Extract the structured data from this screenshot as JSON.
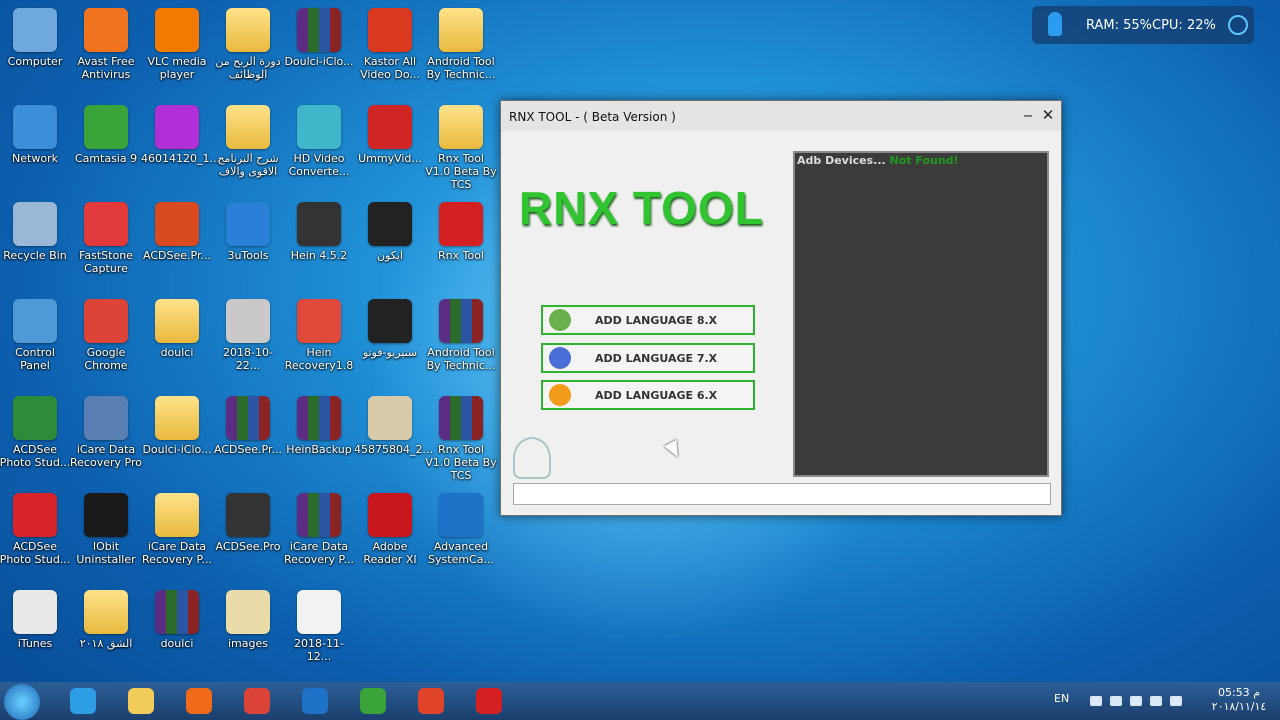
{
  "desktop": {
    "icons": [
      {
        "label": "Computer",
        "color": "#6fa8dc"
      },
      {
        "label": "Avast Free Antivirus",
        "color": "#f0731f"
      },
      {
        "label": "VLC media player",
        "color": "#f07b00"
      },
      {
        "label": "دورة الربح من الوظائف",
        "color": "folder"
      },
      {
        "label": "Doulci-iClo...",
        "color": "rar"
      },
      {
        "label": "Kastor All Video Do...",
        "color": "#d93a1f"
      },
      {
        "label": "Android Tool By Technic...",
        "color": "folder"
      },
      {
        "label": "Network",
        "color": "#3a8fd8"
      },
      {
        "label": "Camtasia 9",
        "color": "#3aa33a"
      },
      {
        "label": "46014120_1...",
        "color": "#b12fd6"
      },
      {
        "label": "شرح البرنامج الاقوى والاف",
        "color": "folder"
      },
      {
        "label": "HD Video Converte...",
        "color": "#3fb6c9"
      },
      {
        "label": "UmmyVid...",
        "color": "#d02525"
      },
      {
        "label": "Rnx Tool V1.0 Beta By TCS",
        "color": "folder"
      },
      {
        "label": "Recycle Bin",
        "color": "#9ab7d6"
      },
      {
        "label": "FastStone Capture",
        "color": "#e23a3a"
      },
      {
        "label": "ACDSee.Pr...",
        "color": "#d94b1f"
      },
      {
        "label": "3uTools",
        "color": "#2a7fd6"
      },
      {
        "label": "Hein 4.5.2",
        "color": "#333333"
      },
      {
        "label": "ايكون",
        "color": "#222222"
      },
      {
        "label": "Rnx Tool",
        "color": "#d42020"
      },
      {
        "label": "Control Panel",
        "color": "#4f9ad6"
      },
      {
        "label": "Google Chrome",
        "color": "#db4437"
      },
      {
        "label": "doulci",
        "color": "folder"
      },
      {
        "label": "2018-10-22...",
        "color": "#c9c9c9"
      },
      {
        "label": "Hein Recovery1.8",
        "color": "#e04a3a"
      },
      {
        "label": "ستيريو-فوتو",
        "color": "#222222"
      },
      {
        "label": "Android Tool By Technic...",
        "color": "rar"
      },
      {
        "label": "ACDSee Photo Stud...",
        "color": "#2e8b3a"
      },
      {
        "label": "iCare Data Recovery Pro",
        "color": "#5a7fb3"
      },
      {
        "label": "Doulci-iClo...",
        "color": "folder"
      },
      {
        "label": "ACDSee.Pr...",
        "color": "rar"
      },
      {
        "label": "HeinBackup",
        "color": "rar"
      },
      {
        "label": "45875804_2...",
        "color": "#d8c9a8"
      },
      {
        "label": "Rnx Tool V1.0 Beta By TCS",
        "color": "rar"
      },
      {
        "label": "ACDSee Photo Stud...",
        "color": "#d8232a"
      },
      {
        "label": "IObit Uninstaller",
        "color": "#1a1a1a"
      },
      {
        "label": "iCare Data Recovery P...",
        "color": "folder"
      },
      {
        "label": "ACDSee.Pro",
        "color": "#333333"
      },
      {
        "label": "iCare Data Recovery P...",
        "color": "rar"
      },
      {
        "label": "Adobe Reader XI",
        "color": "#c8161d"
      },
      {
        "label": "Advanced SystemCa...",
        "color": "#1e73c9"
      },
      {
        "label": "iTunes",
        "color": "#e9e9e9"
      },
      {
        "label": "الشق ٢٠١٨",
        "color": "folder"
      },
      {
        "label": "doulci",
        "color": "rar"
      },
      {
        "label": "images",
        "color": "#e9dca8"
      },
      {
        "label": "2018-11-12...",
        "color": "#f2f2f2"
      }
    ]
  },
  "widget": {
    "ram": "RAM: 55%",
    "cpu": "CPU: 22%"
  },
  "window": {
    "title": "RNX TOOL - ( Beta Version )",
    "minimize": "‒",
    "close": "✕",
    "logo": "RNX TOOL",
    "buttons": [
      {
        "label": "ADD LANGUAGE 8.X",
        "icon": "android-icon",
        "color": "#6ab04c"
      },
      {
        "label": "ADD LANGUAGE 7.X",
        "icon": "nougat-icon",
        "color": "#4a6ed8"
      },
      {
        "label": "ADD LANGUAGE 6.X",
        "icon": "marshmallow-icon",
        "color": "#f39a1a"
      }
    ],
    "adb_label": "Adb Devices...",
    "adb_status": "Not Found!"
  },
  "taskbar": {
    "lang": "EN",
    "time": "05:53 م",
    "date": "٢٠١٨/١١/١٤",
    "apps": [
      {
        "name": "ie-icon",
        "color": "#2e9ee6"
      },
      {
        "name": "explorer-icon",
        "color": "#f2cd5c"
      },
      {
        "name": "media-player-icon",
        "color": "#f06a1a"
      },
      {
        "name": "chrome-icon",
        "color": "#db4437"
      },
      {
        "name": "advanced-systemcare-icon",
        "color": "#1e73c9"
      },
      {
        "name": "camtasia-icon",
        "color": "#3aa33a"
      },
      {
        "name": "camtasia-recorder-icon",
        "color": "#e0452a"
      },
      {
        "name": "rnx-tool-icon",
        "color": "#d42020"
      }
    ]
  }
}
